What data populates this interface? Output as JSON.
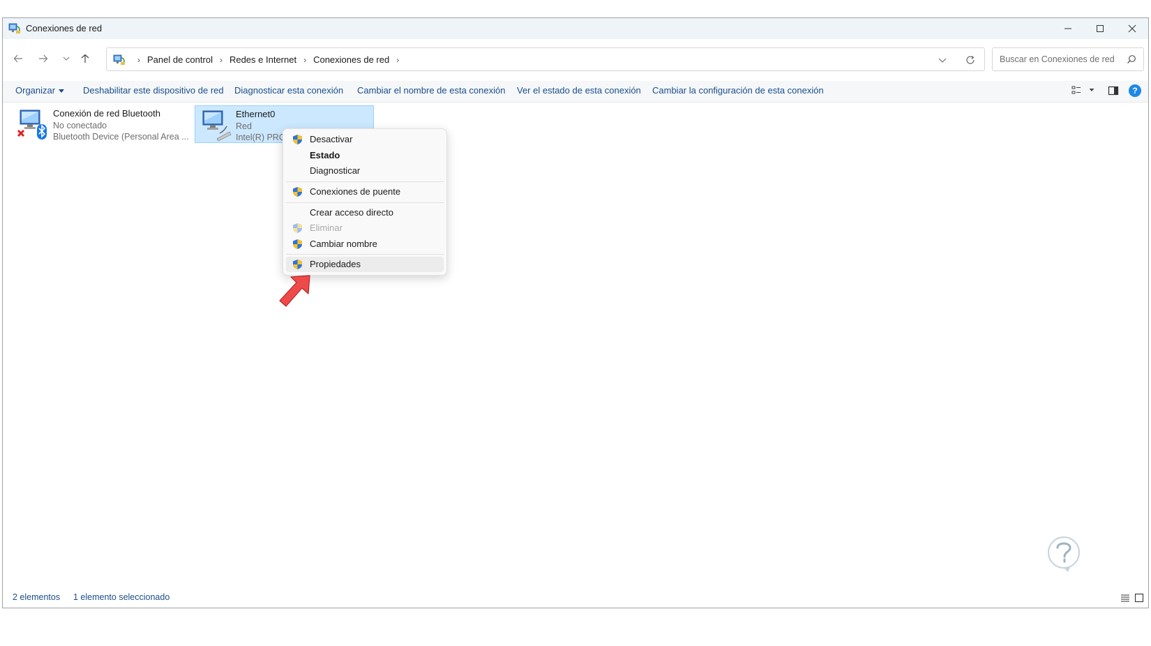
{
  "window": {
    "title": "Conexiones de red"
  },
  "address": {
    "crumbs": [
      "Panel de control",
      "Redes e Internet",
      "Conexiones de red"
    ],
    "search_placeholder": "Buscar en Conexiones de red"
  },
  "commandbar": {
    "organize": "Organizar",
    "disable": "Deshabilitar este dispositivo de red",
    "diagnose": "Diagnosticar esta conexión",
    "rename": "Cambiar el nombre de esta conexión",
    "status": "Ver el estado de esta conexión",
    "settings": "Cambiar la configuración de esta conexión",
    "help": "?"
  },
  "items": [
    {
      "name": "Conexión de red Bluetooth",
      "status": "No conectado",
      "device": "Bluetooth Device (Personal Area ..."
    },
    {
      "name": "Ethernet0",
      "status": "Red",
      "device": "Intel(R) PRO/"
    }
  ],
  "context_menu": {
    "items": [
      {
        "label": "Desactivar",
        "shield": true,
        "bold": false,
        "disabled": false
      },
      {
        "label": "Estado",
        "shield": false,
        "bold": true,
        "disabled": false
      },
      {
        "label": "Diagnosticar",
        "shield": false,
        "bold": false,
        "disabled": false
      },
      {
        "label": "Conexiones de puente",
        "shield": true,
        "bold": false,
        "disabled": false
      },
      {
        "label": "Crear acceso directo",
        "shield": false,
        "bold": false,
        "disabled": false
      },
      {
        "label": "Eliminar",
        "shield": true,
        "bold": false,
        "disabled": true
      },
      {
        "label": "Cambiar nombre",
        "shield": true,
        "bold": false,
        "disabled": false
      },
      {
        "label": "Propiedades",
        "shield": true,
        "bold": false,
        "disabled": false
      }
    ]
  },
  "statusbar": {
    "count": "2 elementos",
    "selected": "1 elemento seleccionado"
  },
  "colors": {
    "link": "#1b4e8a",
    "selection": "#cce8ff",
    "arrow": "#ef4a4a",
    "help": "#1e88e5"
  }
}
